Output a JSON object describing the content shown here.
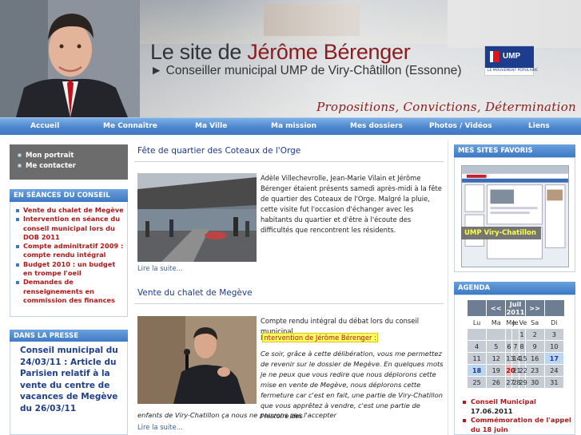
{
  "header": {
    "title_prefix": "Le site de ",
    "title_name": "Jérôme Bérenger",
    "subtitle": "► Conseiller municipal UMP de Viry-Châtillon (Essonne)",
    "tagline": "Propositions, Convictions, Détermination",
    "logo_text": "UMP",
    "logo_subtext": "LE MOUVEMENT POPULAIRE"
  },
  "nav": {
    "items": [
      "Accueil",
      "Me Connaître",
      "Ma Ville",
      "Ma mission",
      "Mes dossiers",
      "Photos / Vidéos",
      "Liens"
    ]
  },
  "left": {
    "profile_links": [
      "Mon portrait",
      "Me contacter"
    ],
    "seances_heading": "EN SÉANCES DU CONSEIL",
    "seances_items": [
      "Vente du chalet de Megève",
      "Intervention en séance du conseil municipal lors du DOB 2011",
      "Compte adminitratif 2009 : compte rendu intégral",
      "Budget 2010 : un budget en trompe l'oeil",
      "Demandes de renseignements en commission des finances"
    ],
    "presse_heading": "DANS LA PRESSE",
    "presse_text": "Conseil municipal du 24/03/11 : Article du Parisien relatif à la vente du centre de vacances de Megève du 26/03/11"
  },
  "posts": [
    {
      "title": "Fête de quartier des Coteaux de l'Orge",
      "body": "Adèle Villechevrolle, Jean-Marie Vilain et Jérôme Bérenger étaient présents samedi après-midi à la fête de quartier des Coteaux de l'Orge. Malgré la pluie, cette visite fut l'occasion d'échanger avec les habitants du quartier et d'être à l'écoute des difficultés que rencontrent les résidents.",
      "readmore": "Lire la suite..."
    },
    {
      "title": "Vente du chalet de Megève",
      "intro": "Compte rendu intégral du débat lors du conseil municipal",
      "link_prefix": "I",
      "link_text": "ntervention de Jérôme Bérenger :",
      "quote": "Ce soir, grâce à cette délibération, vous me permettez de revenir sur le dossier de Megève. En quelques mots je ne peux que vous redire que nous déplorons cette mise en vente de Megève, nous déplorons cette fermeture car c'est en fait, une partie de Viry-Chatillon que vous apprêtez à vendre, c'est une partie de l'histoire des",
      "quote_last": "enfants de Viry-Chatillon ça nous ne pouvons pas l'accepter",
      "readmore": "Lire la suite..."
    }
  ],
  "right": {
    "favoris_heading": "MES SITES FAVORIS",
    "favoris_label": "UMP Viry-Chatillon",
    "agenda_heading": "AGENDA",
    "calendar": {
      "prev": "<<",
      "month": "Juil 2011",
      "next": ">>",
      "weekdays": [
        "Lu",
        "Ma",
        "Me",
        "Je",
        "Ve",
        "Sa",
        "Di"
      ],
      "weeks": [
        [
          "",
          "",
          "",
          "",
          "1",
          "2",
          "3"
        ],
        [
          "4",
          "5",
          "6",
          "7",
          "8",
          "9",
          "10"
        ],
        [
          "11",
          "12",
          "13",
          "14",
          "15",
          "16",
          "17"
        ],
        [
          "18",
          "19",
          "20",
          "21",
          "22",
          "23",
          "24"
        ],
        [
          "25",
          "26",
          "27",
          "28",
          "29",
          "30",
          "31"
        ]
      ],
      "events": [
        "17",
        "18"
      ],
      "today": "20"
    },
    "agenda_items": [
      {
        "title": "Conseil Municipal",
        "date": "17.06.2011"
      },
      {
        "title": "Commémoration de l'appel du 18 juin",
        "date": ""
      }
    ]
  }
}
